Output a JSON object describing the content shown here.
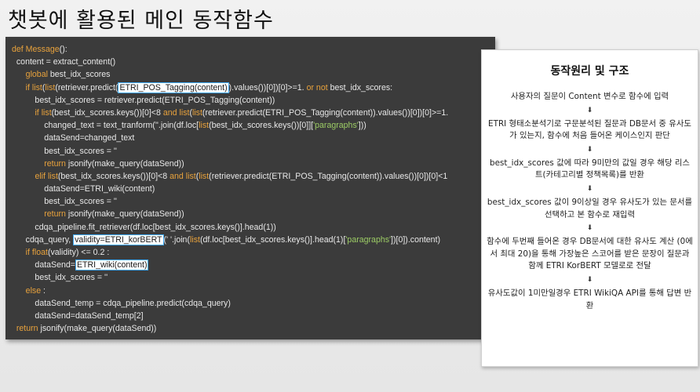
{
  "title": "챗봇에 활용된 메인 동작함수",
  "code": {
    "lines": [
      [
        {
          "t": "def ",
          "c": "kw"
        },
        {
          "t": "Message",
          "c": "kw"
        },
        {
          "t": "():"
        }
      ],
      [
        {
          "t": "  content = extract_content()"
        }
      ],
      [
        {
          "t": "      "
        },
        {
          "t": "global",
          "c": "kw"
        },
        {
          "t": " best_idx_scores"
        }
      ],
      [
        {
          "t": "      "
        },
        {
          "t": "if",
          "c": "kw"
        },
        {
          "t": " "
        },
        {
          "t": "list",
          "c": "kw"
        },
        {
          "t": "("
        },
        {
          "t": "list",
          "c": "kw"
        },
        {
          "t": "(retriever.predict("
        },
        {
          "t": "ETRI_POS_Tagging(content)",
          "c": "hl"
        },
        {
          "t": ").values())[0])[0]>=1. "
        },
        {
          "t": "or not",
          "c": "kw"
        },
        {
          "t": " best_idx_scores:"
        }
      ],
      [
        {
          "t": "          best_idx_scores = retriever.predict(ETRI_POS_Tagging(content))"
        }
      ],
      [
        {
          "t": "          "
        },
        {
          "t": "if",
          "c": "kw"
        },
        {
          "t": " "
        },
        {
          "t": "list",
          "c": "kw"
        },
        {
          "t": "(best_idx_scores.keys())[0]<8 "
        },
        {
          "t": "and",
          "c": "kw"
        },
        {
          "t": " "
        },
        {
          "t": "list",
          "c": "kw"
        },
        {
          "t": "("
        },
        {
          "t": "list",
          "c": "kw"
        },
        {
          "t": "(retriever.predict(ETRI_POS_Tagging(content)).values())[0])[0]>=1."
        }
      ],
      [
        {
          "t": "              changed_text = text_tranform(''.join(df.loc["
        },
        {
          "t": "list",
          "c": "kw"
        },
        {
          "t": "(best_idx_scores.keys())[0]]["
        },
        {
          "t": "'paragraphs'",
          "c": "str"
        },
        {
          "t": "]))"
        }
      ],
      [
        {
          "t": "              dataSend=changed_text"
        }
      ],
      [
        {
          "t": "              best_idx_scores = ''"
        }
      ],
      [
        {
          "t": "              "
        },
        {
          "t": "return",
          "c": "kw"
        },
        {
          "t": " jsonify(make_query(dataSend))"
        }
      ],
      [
        {
          "t": "          "
        },
        {
          "t": "elif",
          "c": "kw"
        },
        {
          "t": " "
        },
        {
          "t": "list",
          "c": "kw"
        },
        {
          "t": "(best_idx_scores.keys())[0]<8 "
        },
        {
          "t": "and",
          "c": "kw"
        },
        {
          "t": " "
        },
        {
          "t": "list",
          "c": "kw"
        },
        {
          "t": "("
        },
        {
          "t": "list",
          "c": "kw"
        },
        {
          "t": "(retriever.predict(ETRI_POS_Tagging(content)).values())[0])[0]<1"
        }
      ],
      [
        {
          "t": "              dataSend=ETRI_wiki(content)"
        }
      ],
      [
        {
          "t": "              best_idx_scores = ''"
        }
      ],
      [
        {
          "t": "              "
        },
        {
          "t": "return",
          "c": "kw"
        },
        {
          "t": " jsonify(make_query(dataSend))"
        }
      ],
      [
        {
          "t": "          cdqa_pipeline.fit_retriever(df.loc[best_idx_scores.keys()].head(1))"
        }
      ],
      [
        {
          "t": "      cdqa_query, "
        },
        {
          "t": "validity=ETRI_korBERT",
          "c": "hl"
        },
        {
          "t": "(' '.join("
        },
        {
          "t": "list",
          "c": "kw"
        },
        {
          "t": "(df.loc[best_idx_scores.keys()].head(1)["
        },
        {
          "t": "'paragraphs'",
          "c": "str"
        },
        {
          "t": "])[0]).content)"
        }
      ],
      [
        {
          "t": "      "
        },
        {
          "t": "if",
          "c": "kw"
        },
        {
          "t": " "
        },
        {
          "t": "float",
          "c": "kw"
        },
        {
          "t": "(validity) <= 0.2 :"
        }
      ],
      [
        {
          "t": "          dataSend="
        },
        {
          "t": "ETRI_wiki(content)",
          "c": "hl"
        }
      ],
      [
        {
          "t": "          best_idx_scores = ''"
        }
      ],
      [
        {
          "t": "      "
        },
        {
          "t": "else",
          "c": "kw"
        },
        {
          "t": " :"
        }
      ],
      [
        {
          "t": "          dataSend_temp = cdqa_pipeline.predict(cdqa_query)"
        }
      ],
      [
        {
          "t": "          dataSend=dataSend_temp[2]"
        }
      ],
      [
        {
          "t": "  "
        },
        {
          "t": "return",
          "c": "kw"
        },
        {
          "t": " jsonify(make_query(dataSend))"
        }
      ]
    ]
  },
  "info": {
    "title": "동작원리 및 구조",
    "arrow_glyph": "⬇",
    "steps": [
      "사용자의 질문이 Content 변수로 함수에 입력",
      "ETRI 형태소분석기로 구문분석된 질문과 DB문서 중 유사도가 있는지, 함수에 처음 들어온 케이스인지 판단",
      "best_idx_scores 값에 따라 9미만의 값일 경우 해당 리스트(카테고리별 정책목록)를 반환",
      "best_idx_scores 값이 9이상일 경우 유사도가 있는 문서를 선택하고 본 함수로 재입력",
      "함수에 두번째 들어온 경우 DB문서에 대한 유사도 계산 (0에서 최대 20)을 통해 가장높은 스코어를 받은 문장이 질문과 함께 ETRI KorBERT 모델로로 전달",
      "유사도값이 1미만일경우 ETRI WikiQA API를 통해 답변 반환"
    ]
  }
}
